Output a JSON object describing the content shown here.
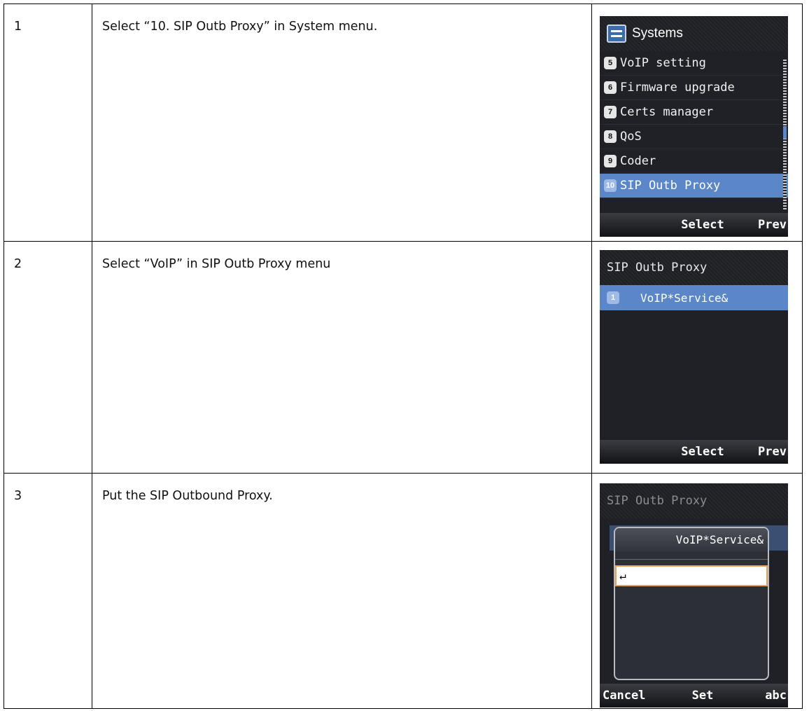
{
  "rows": [
    {
      "number": "1",
      "instruction": "Select “10. SIP Outb Proxy” in System menu.",
      "screen": {
        "title": "Systems",
        "icon": "systems-icon",
        "items": [
          {
            "num": "5",
            "label": "VoIP setting"
          },
          {
            "num": "6",
            "label": "Firmware upgrade"
          },
          {
            "num": "7",
            "label": "Certs manager"
          },
          {
            "num": "8",
            "label": "QoS"
          },
          {
            "num": "9",
            "label": "Coder"
          },
          {
            "num": "10",
            "label": "SIP Outb Proxy",
            "selected": true
          }
        ],
        "softkeys": {
          "left": "",
          "middle": "Select",
          "right": "Prev"
        }
      }
    },
    {
      "number": "2",
      "instruction": "Select “VoIP” in SIP Outb Proxy menu",
      "screen": {
        "title": "SIP Outb Proxy",
        "items": [
          {
            "num": "1",
            "label": "VoIP*Service&"
          }
        ],
        "softkeys": {
          "left": "",
          "middle": "Select",
          "right": "Prev"
        }
      }
    },
    {
      "number": "3",
      "instruction": "Put the SIP Outbound Proxy.",
      "screen": {
        "title": "SIP Outb Proxy",
        "dialog_title": "VoIP*Service&",
        "input_value": "↵",
        "softkeys": {
          "left": "Cancel",
          "middle": "Set",
          "right": "abc"
        }
      }
    }
  ],
  "colors": {
    "highlight": "#5b87c8",
    "screen_bg": "#1f2126",
    "input_border": "#e5a45a"
  }
}
